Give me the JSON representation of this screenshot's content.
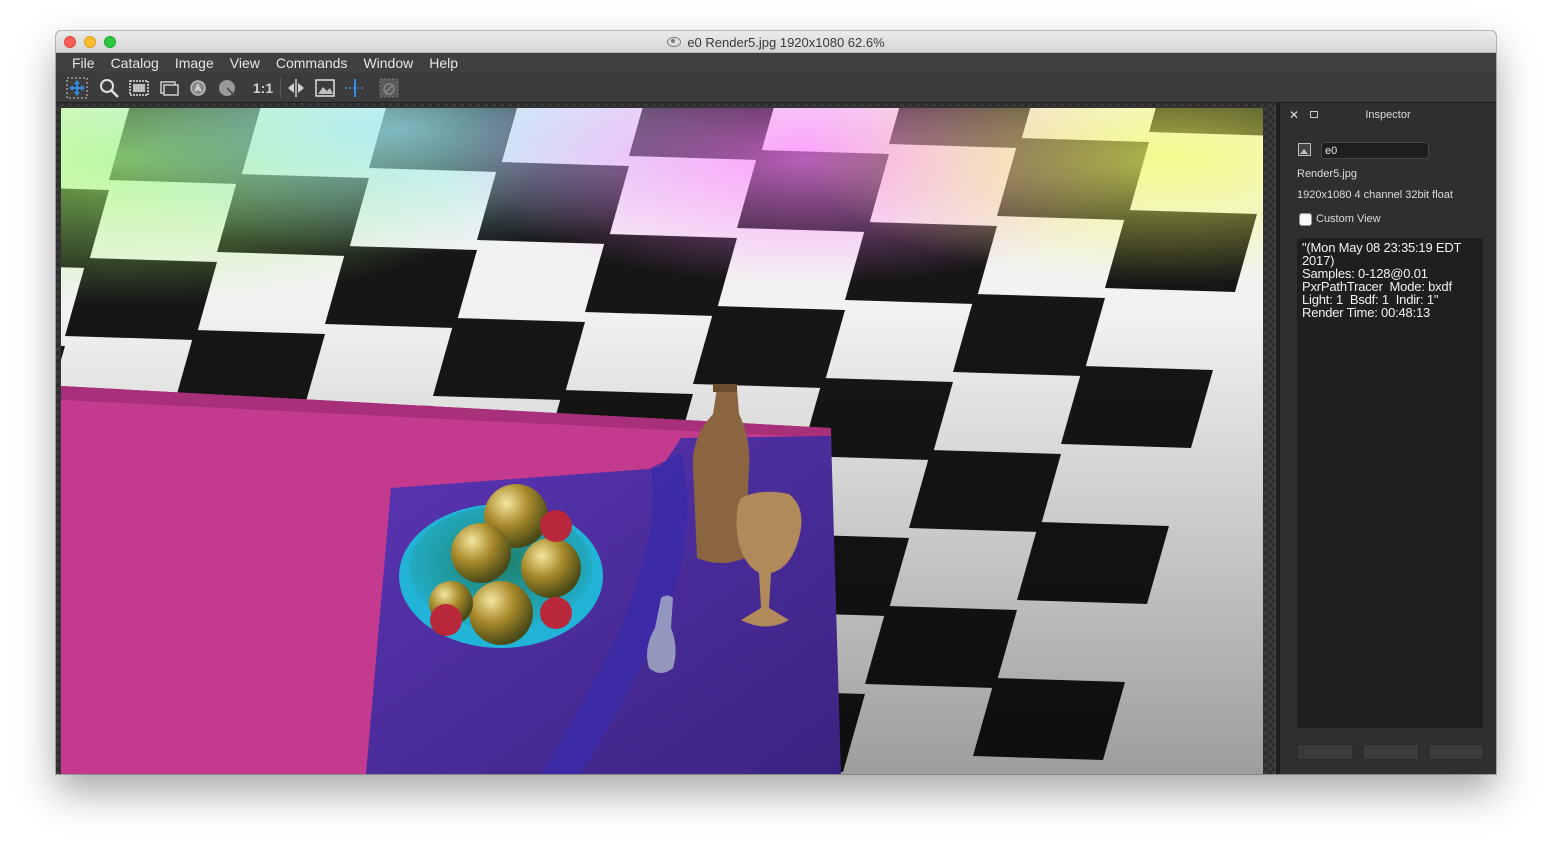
{
  "window": {
    "title": "e0 Render5.jpg 1920x1080 62.6%"
  },
  "menu": [
    "File",
    "Catalog",
    "Image",
    "View",
    "Commands",
    "Window",
    "Help"
  ],
  "toolbar": {
    "tools": [
      {
        "name": "pan-tool-icon",
        "glyph": "✥"
      },
      {
        "name": "zoom-tool-icon",
        "glyph": "⚲"
      },
      {
        "name": "fit-frame-icon",
        "glyph": "▣"
      },
      {
        "name": "frame-stack-icon",
        "glyph": "▤"
      },
      {
        "name": "color-picker-icon",
        "glyph": "⚙"
      },
      {
        "name": "channel-mode-icon",
        "glyph": "◉"
      },
      {
        "name": "actual-size-icon",
        "glyph": "1:1"
      },
      {
        "name": "flip-horizontal-icon",
        "glyph": "◂▸"
      },
      {
        "name": "image-view-icon",
        "glyph": "▨"
      },
      {
        "name": "wipe-line-icon",
        "glyph": "┿"
      },
      {
        "name": "clear-disabled-icon",
        "glyph": "⊘"
      }
    ]
  },
  "inspector": {
    "title": "Inspector",
    "close_glyph": "✕",
    "name_value": "e0",
    "filename": "Render5.jpg",
    "info": "1920x1080 4 channel 32bit float",
    "custom_view_label": "Custom View",
    "custom_view_checked": false,
    "notes": "\"(Mon May 08 23:35:19 EDT\n2017)\nSamples: 0-128@0.01\nPxrPathTracer  Mode: bxdf\nLight: 1  Bsdf: 1  Indir: 1\"\nRender Time: 00:48:13"
  },
  "colors": {
    "accent_blue": "#2f8de4",
    "table_pink": "#c43a8e",
    "cloth_purple": "#4a2a9a",
    "bowl_cyan": "#25b9cf"
  }
}
